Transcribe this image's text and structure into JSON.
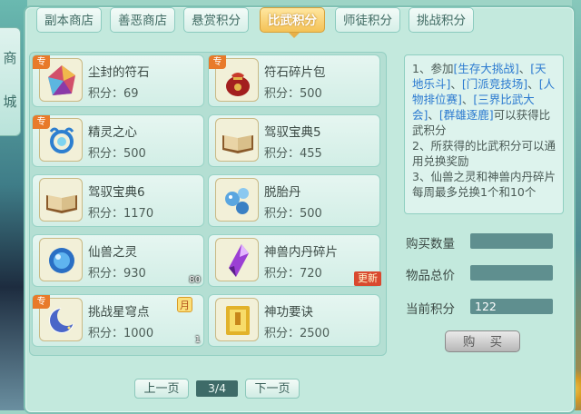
{
  "side_tab": {
    "chars": [
      "商",
      "城"
    ]
  },
  "tabs": [
    {
      "label": "副本商店",
      "active": false
    },
    {
      "label": "善恶商店",
      "active": false
    },
    {
      "label": "悬赏积分",
      "active": false
    },
    {
      "label": "比武积分",
      "active": true
    },
    {
      "label": "师徒积分",
      "active": false
    },
    {
      "label": "挑战积分",
      "active": false
    }
  ],
  "price_prefix": "积分：",
  "items": [
    {
      "name": "尘封的符石",
      "price": "69",
      "icon": "rune-stone-icon",
      "tag": "专",
      "qty": "",
      "badge": ""
    },
    {
      "name": "符石碎片包",
      "price": "500",
      "icon": "rune-fragment-bag-icon",
      "tag": "专",
      "qty": "",
      "badge": ""
    },
    {
      "name": "精灵之心",
      "price": "500",
      "icon": "spirit-heart-icon",
      "tag": "专",
      "qty": "",
      "badge": ""
    },
    {
      "name": "驾驭宝典5",
      "price": "455",
      "icon": "book-icon",
      "tag": "",
      "qty": "",
      "badge": ""
    },
    {
      "name": "驾驭宝典6",
      "price": "1170",
      "icon": "book-icon",
      "tag": "",
      "qty": "",
      "badge": ""
    },
    {
      "name": "脱胎丹",
      "price": "500",
      "icon": "pill-icon",
      "tag": "",
      "qty": "",
      "badge": ""
    },
    {
      "name": "仙兽之灵",
      "price": "930",
      "icon": "beast-spirit-orb-icon",
      "tag": "",
      "qty": "80",
      "badge": ""
    },
    {
      "name": "神兽内丹碎片",
      "price": "720",
      "icon": "crystal-shard-icon",
      "tag": "",
      "qty": "130",
      "badge": "更新"
    },
    {
      "name": "挑战星穹点",
      "price": "1000",
      "icon": "crescent-moon-icon",
      "tag": "专",
      "qty": "1",
      "badge": "月"
    },
    {
      "name": "神功要诀",
      "price": "2500",
      "icon": "scroll-manual-icon",
      "tag": "",
      "qty": "",
      "badge": ""
    }
  ],
  "pagination": {
    "prev": "上一页",
    "indicator": "3/4",
    "next": "下一页"
  },
  "info": {
    "p1_a": "1、参加",
    "p1_l1": "[生存大挑战]",
    "p1_s1": "、",
    "p1_l2": "[天地乐斗]",
    "p1_s2": "、",
    "p1_l3": "[门派竞技场]",
    "p1_s3": "、",
    "p1_l4": "[人物排位赛]",
    "p1_s4": "、",
    "p1_l5": "[三界比武大会]",
    "p1_s5": "、",
    "p1_l6": "[群雄逐鹿]",
    "p1_b": "可以获得比武积分",
    "p2": "2、所获得的比武积分可以通用兑换奖励",
    "p3": "3、仙兽之灵和神兽内丹碎片每周最多兑换1个和10个"
  },
  "form": {
    "quantity_label": "购买数量",
    "quantity_value": "",
    "total_label": "物品总价",
    "total_value": "",
    "points_label": "当前积分",
    "points_value": "122",
    "buy_label": "购 买"
  }
}
